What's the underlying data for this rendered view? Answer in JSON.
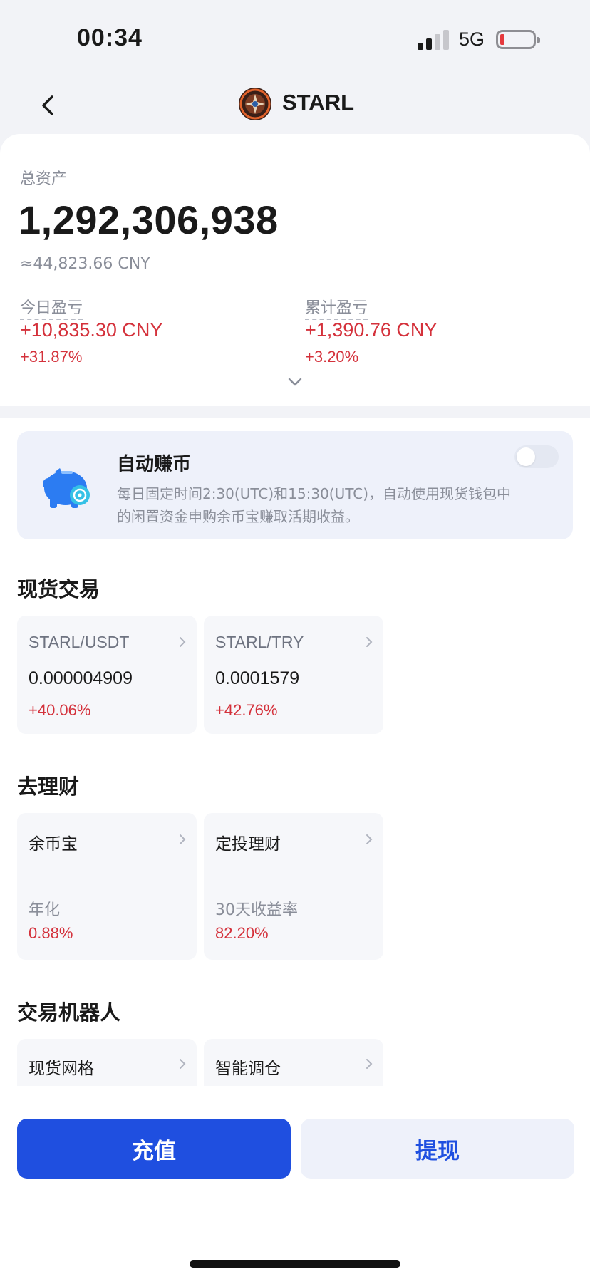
{
  "status_bar": {
    "time": "00:34",
    "network": "5G"
  },
  "nav": {
    "title": "STARL"
  },
  "summary": {
    "total_label": "总资产",
    "total_value": "1,292,306,938",
    "approx_cny": "≈44,823.66 CNY",
    "today_label": "今日盈亏",
    "today_value": "+10,835.30 CNY",
    "today_pct": "+31.87%",
    "cumulative_label": "累计盈亏",
    "cumulative_value": "+1,390.76 CNY",
    "cumulative_pct": "+3.20%"
  },
  "auto_earn": {
    "title": "自动赚币",
    "description": "每日固定时间2:30(UTC)和15:30(UTC)，自动使用现货钱包中的闲置资金申购余币宝赚取活期收益。",
    "enabled": false
  },
  "spot": {
    "title": "现货交易",
    "pairs": [
      {
        "name": "STARL/USDT",
        "price": "0.000004909",
        "change": "+40.06%"
      },
      {
        "name": "STARL/TRY",
        "price": "0.0001579",
        "change": "+42.76%"
      }
    ]
  },
  "finance": {
    "title": "去理财",
    "items": [
      {
        "name": "余币宝",
        "metric_label": "年化",
        "metric_value": "0.88%"
      },
      {
        "name": "定投理财",
        "metric_label": "30天收益率",
        "metric_value": "82.20%"
      }
    ]
  },
  "bots": {
    "title": "交易机器人",
    "items": [
      {
        "name": "现货网格"
      },
      {
        "name": "智能调仓"
      }
    ]
  },
  "actions": {
    "deposit": "充值",
    "withdraw": "提现"
  },
  "colors": {
    "accent": "#1f4fe0",
    "positive": "#d4313b"
  }
}
